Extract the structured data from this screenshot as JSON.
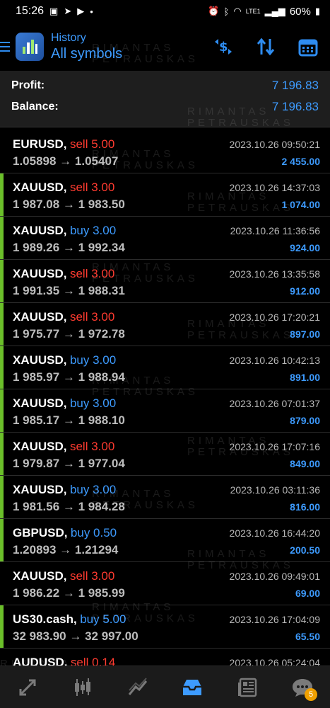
{
  "status": {
    "time": "15:26",
    "battery": "60%",
    "network": "LTE1"
  },
  "header": {
    "subtitle": "History",
    "title": "All symbols"
  },
  "summary": {
    "profit_label": "Profit:",
    "profit_value": "7 196.83",
    "balance_label": "Balance:",
    "balance_value": "7 196.83"
  },
  "watermark": {
    "line1": "RIMANTAS",
    "line2": "PETRAUSKAS"
  },
  "trades": [
    {
      "symbol": "EURUSD,",
      "side": "sell 5.00",
      "type": "sell",
      "date": "2023.10.26 09:50:21",
      "prices": "1.05898 → 1.05407",
      "profit": "2 455.00",
      "accent": false
    },
    {
      "symbol": "XAUUSD,",
      "side": "sell 3.00",
      "type": "sell",
      "date": "2023.10.26 14:37:03",
      "prices": "1 987.08 → 1 983.50",
      "profit": "1 074.00",
      "accent": true
    },
    {
      "symbol": "XAUUSD,",
      "side": "buy 3.00",
      "type": "buy",
      "date": "2023.10.26 11:36:56",
      "prices": "1 989.26 → 1 992.34",
      "profit": "924.00",
      "accent": true
    },
    {
      "symbol": "XAUUSD,",
      "side": "sell 3.00",
      "type": "sell",
      "date": "2023.10.26 13:35:58",
      "prices": "1 991.35 → 1 988.31",
      "profit": "912.00",
      "accent": true
    },
    {
      "symbol": "XAUUSD,",
      "side": "sell 3.00",
      "type": "sell",
      "date": "2023.10.26 17:20:21",
      "prices": "1 975.77 → 1 972.78",
      "profit": "897.00",
      "accent": true
    },
    {
      "symbol": "XAUUSD,",
      "side": "buy 3.00",
      "type": "buy",
      "date": "2023.10.26 10:42:13",
      "prices": "1 985.97 → 1 988.94",
      "profit": "891.00",
      "accent": true
    },
    {
      "symbol": "XAUUSD,",
      "side": "buy 3.00",
      "type": "buy",
      "date": "2023.10.26 07:01:37",
      "prices": "1 985.17 → 1 988.10",
      "profit": "879.00",
      "accent": true
    },
    {
      "symbol": "XAUUSD,",
      "side": "sell 3.00",
      "type": "sell",
      "date": "2023.10.26 17:07:16",
      "prices": "1 979.87 → 1 977.04",
      "profit": "849.00",
      "accent": true
    },
    {
      "symbol": "XAUUSD,",
      "side": "buy 3.00",
      "type": "buy",
      "date": "2023.10.26 03:11:36",
      "prices": "1 981.56 → 1 984.28",
      "profit": "816.00",
      "accent": true
    },
    {
      "symbol": "GBPUSD,",
      "side": "buy 0.50",
      "type": "buy",
      "date": "2023.10.26 16:44:20",
      "prices": "1.20893 → 1.21294",
      "profit": "200.50",
      "accent": true
    },
    {
      "symbol": "XAUUSD,",
      "side": "sell 3.00",
      "type": "sell",
      "date": "2023.10.26 09:49:01",
      "prices": "1 986.22 → 1 985.99",
      "profit": "69.00",
      "accent": false
    },
    {
      "symbol": "US30.cash,",
      "side": "buy 5.00",
      "type": "buy",
      "date": "2023.10.26 17:04:09",
      "prices": "32 983.90 → 32 997.00",
      "profit": "65.50",
      "accent": true
    },
    {
      "symbol": "AUDUSD,",
      "side": "sell 0.14",
      "type": "sell",
      "date": "2023.10.26 05:24:04",
      "prices": "",
      "profit": "",
      "accent": false
    }
  ],
  "nav": {
    "badge": "5"
  },
  "colors": {
    "accent_blue": "#3d9bff",
    "sell_red": "#ff3b30",
    "row_accent": "#6bbf2a",
    "badge": "#f0a000"
  }
}
